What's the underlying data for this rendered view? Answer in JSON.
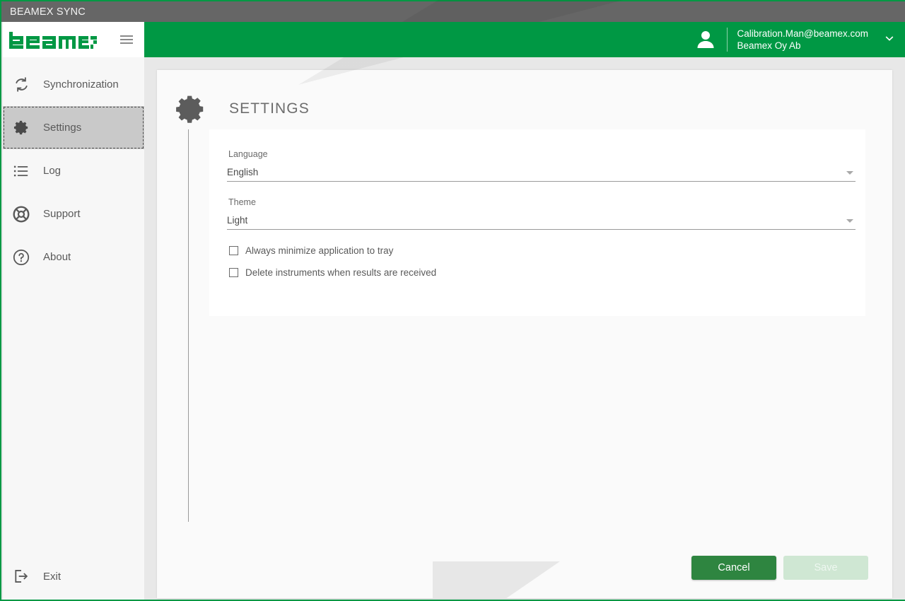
{
  "window": {
    "title": "BEAMEX SYNC"
  },
  "brand": {
    "logo_text": "beamex",
    "accent_green": "#009844",
    "titlebar_gray": "#666666"
  },
  "sidebar": {
    "menu_icon": "hamburger-icon",
    "items": [
      {
        "label": "Synchronization",
        "icon": "sync-icon",
        "selected": false
      },
      {
        "label": "Settings",
        "icon": "gear-icon",
        "selected": true
      },
      {
        "label": "Log",
        "icon": "list-icon",
        "selected": false
      },
      {
        "label": "Support",
        "icon": "lifebuoy-icon",
        "selected": false
      },
      {
        "label": "About",
        "icon": "question-circle-icon",
        "selected": false
      }
    ],
    "bottom_item": {
      "label": "Exit",
      "icon": "exit-icon"
    }
  },
  "header": {
    "avatar_icon": "user-avatar-icon",
    "user_email": "Calibration.Man@beamex.com",
    "organization": "Beamex Oy Ab",
    "dropdown_icon": "chevron-down-icon"
  },
  "main": {
    "page_icon": "gear-icon",
    "page_title": "SETTINGS",
    "fields": [
      {
        "label": "Language",
        "value": "English",
        "caret_icon": "caret-down-icon"
      },
      {
        "label": "Theme",
        "value": "Light",
        "caret_icon": "caret-down-icon"
      }
    ],
    "checkboxes": [
      {
        "label": "Always minimize application to tray",
        "checked": false
      },
      {
        "label": "Delete instruments when results are received",
        "checked": false
      }
    ],
    "buttons": {
      "cancel": "Cancel",
      "save": "Save",
      "save_disabled": true
    }
  }
}
